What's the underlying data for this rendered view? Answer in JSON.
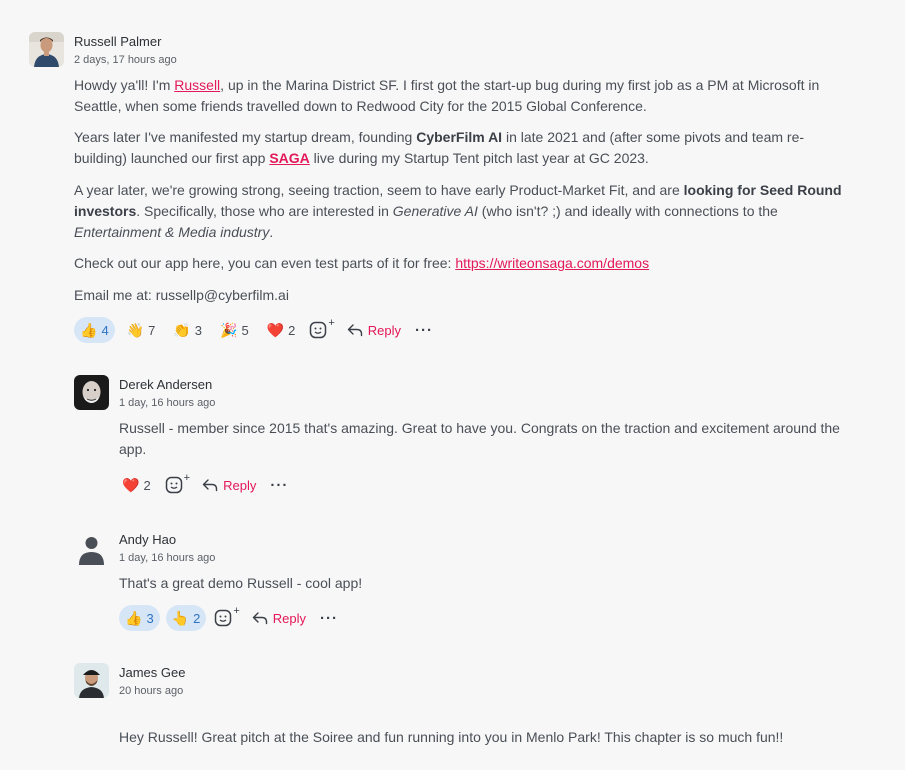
{
  "post": {
    "author": "Russell Palmer",
    "time": "2 days, 17 hours ago",
    "p1": {
      "pre": "Howdy ya'll! I'm ",
      "link": "Russell",
      "post_line1": ", up in the Marina District SF. I first got the start-up bug during my first job as a PM at Microsoft in",
      "line2": "Seattle, when some friends travelled down to Redwood City for the 2015 Global Conference."
    },
    "p2": {
      "pre": "Years later I've manifested my startup dream, founding ",
      "bold": "CyberFilm AI",
      "post_line1": " in late 2021 and (after some pivots and team re-",
      "line2_pre": "building) launched our first app ",
      "link": "SAGA",
      "line2_post": " live during my Startup Tent pitch last year at GC 2023."
    },
    "p3": {
      "pre": "A year later, we're growing strong, seeing traction, seem to have early Product-Market Fit, and are ",
      "bold1": "looking for Seed Round",
      "bold2": "investors",
      "mid": ". Specifically, those who are interested in ",
      "ital1": "Generative AI",
      "post": " (who isn't? ;) and ideally with connections to the",
      "ital2": "Entertainment & Media industry",
      "end": "."
    },
    "p4": {
      "pre": "Check out our app here, you can even test parts of it for free: ",
      "link": "https://writeonsaga.com/demos"
    },
    "p5": "Email me at: russellp@cyberfilm.ai",
    "reactions": [
      {
        "emoji": "👍",
        "count": "4",
        "active": true
      },
      {
        "emoji": "👋",
        "count": "7",
        "active": false
      },
      {
        "emoji": "👏",
        "count": "3",
        "active": false
      },
      {
        "emoji": "🎉",
        "count": "5",
        "active": false
      },
      {
        "emoji": "❤️",
        "count": "2",
        "active": false
      }
    ],
    "reply_label": "Reply",
    "more_label": "···"
  },
  "comments": [
    {
      "author": "Derek Andersen",
      "time": "1 day, 16 hours ago",
      "line1": "Russell - member since 2015 that's amazing. Great to have you. Congrats on the traction and excitement around the",
      "line2": "app.",
      "reactions": [
        {
          "emoji": "❤️",
          "count": "2",
          "active": false
        }
      ],
      "reply_label": "Reply"
    },
    {
      "author": "Andy Hao",
      "time": "1 day, 16 hours ago",
      "line1": "That's a great demo Russell - cool app!",
      "reactions": [
        {
          "emoji": "👍",
          "count": "3",
          "active": true
        },
        {
          "emoji": "👆",
          "count": "2",
          "active": true
        }
      ],
      "reply_label": "Reply"
    },
    {
      "author": "James Gee",
      "time": "20 hours ago",
      "line1": "Hey Russell! Great pitch at the Soiree and fun running into you in Menlo Park! This chapter is so much fun!!"
    }
  ],
  "colors": {
    "accent": "#e3185a",
    "active_pill_bg": "#d6e6f7",
    "active_pill_text": "#2f74c0",
    "background": "#f7f7f7"
  },
  "icons": [
    "add-reaction-icon",
    "reply-arrow-icon",
    "more-options-icon",
    "default-user-icon"
  ]
}
